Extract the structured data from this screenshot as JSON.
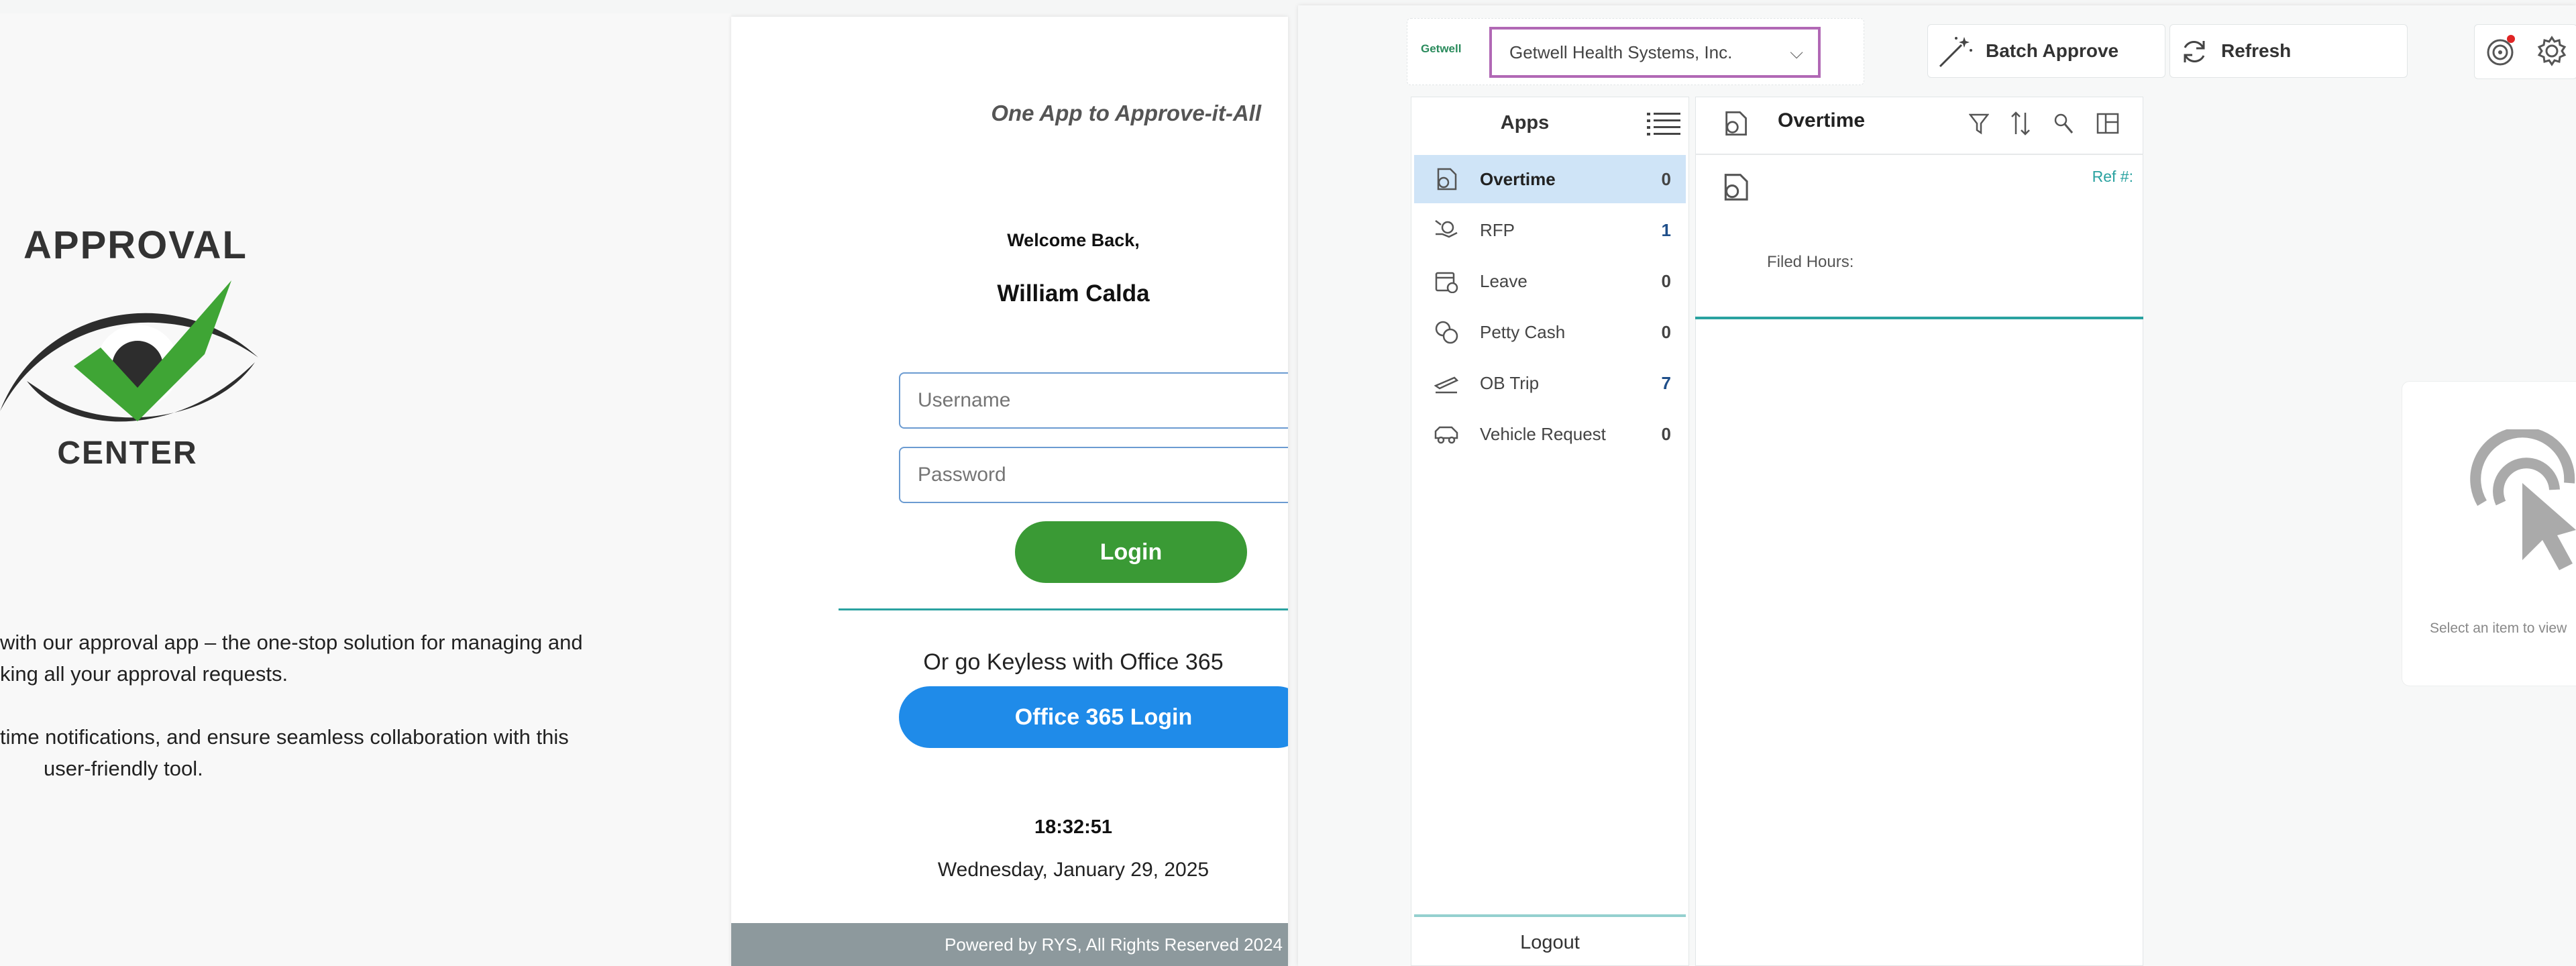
{
  "brand": {
    "logo_top": "APPROVAL",
    "logo_bottom": "CENTER",
    "desc_line1": "with our approval app – the one-stop solution for managing and",
    "desc_line2": "king all your approval requests.",
    "desc_line3": "time notifications, and ensure seamless collaboration with this",
    "desc_line4": "user-friendly tool."
  },
  "login": {
    "tagline": "One App to Approve-it-All",
    "welcome": "Welcome Back,",
    "user_name": "William Calda",
    "username_placeholder": "Username",
    "password_placeholder": "Password",
    "login_button": "Login",
    "keyless_text": "Or go Keyless with Office 365",
    "office_button": "Office 365 Login",
    "time": "18:32:51",
    "date": "Wednesday, January 29, 2025",
    "footer": "Powered by RYS, All Rights Reserved 2024"
  },
  "toolbar": {
    "company_logo_text": "Getwell",
    "company": "Getwell Health Systems, Inc.",
    "batch_approve": "Batch Approve",
    "refresh": "Refresh"
  },
  "apps_panel": {
    "title": "Apps",
    "items": [
      {
        "label": "Overtime",
        "count": "0",
        "icon": "clock-document-icon"
      },
      {
        "label": "RFP",
        "count": "1",
        "icon": "hand-money-icon"
      },
      {
        "label": "Leave",
        "count": "0",
        "icon": "calendar-clock-icon"
      },
      {
        "label": "Petty Cash",
        "count": "0",
        "icon": "coins-icon"
      },
      {
        "label": "OB Trip",
        "count": "7",
        "icon": "plane-takeoff-icon"
      },
      {
        "label": "Vehicle Request",
        "count": "0",
        "icon": "car-icon"
      }
    ],
    "logout": "Logout"
  },
  "detail_panel": {
    "title": "Overtime",
    "ref_label": "Ref #:",
    "filed_hours_label": "Filed Hours:"
  },
  "empty_state": {
    "text": "Select an item to view"
  },
  "colors": {
    "login_green": "#3a9a35",
    "office_blue": "#1f8be9",
    "active_item": "#cfe4f7",
    "company_border": "#b168b5",
    "teal_divider": "#2aa2a0",
    "footer_gray": "#8d999d"
  }
}
